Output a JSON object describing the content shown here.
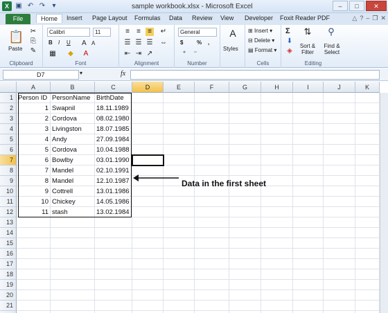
{
  "window": {
    "title": "sample workbook.xlsx - Microsoft Excel",
    "minimize": "–",
    "maximize": "□",
    "close": "✕"
  },
  "tabs": [
    "File",
    "Home",
    "Insert",
    "Page Layout",
    "Formulas",
    "Data",
    "Review",
    "View",
    "Developer",
    "Foxit Reader PDF"
  ],
  "ribbon": {
    "clipboard": {
      "label": "Clipboard",
      "paste": "Paste"
    },
    "font": {
      "label": "Font",
      "name": "Calibri",
      "size": "11",
      "bold": "B",
      "italic": "I",
      "underline": "U",
      "grow": "A",
      "shrink": "A"
    },
    "alignment": {
      "label": "Alignment"
    },
    "number": {
      "label": "Number",
      "format": "General",
      "currency": "$",
      "percent": "%",
      "comma": ","
    },
    "styles": {
      "label": "Styles"
    },
    "cells": {
      "label": "Cells",
      "insert": "Insert",
      "delete": "Delete",
      "format": "Format"
    },
    "editing": {
      "label": "Editing",
      "sum": "Σ",
      "sort": "Sort & Filter",
      "find": "Find & Select"
    }
  },
  "formula_bar": {
    "name_box": "D7",
    "fx": "fx",
    "value": ""
  },
  "columns": [
    "A",
    "B",
    "C",
    "D",
    "E",
    "F",
    "G",
    "H",
    "I",
    "J",
    "K"
  ],
  "rows": [
    "1",
    "2",
    "3",
    "4",
    "5",
    "6",
    "7",
    "8",
    "9",
    "10",
    "11",
    "12",
    "13",
    "14",
    "15",
    "16",
    "17",
    "18",
    "19",
    "20",
    "21",
    "22"
  ],
  "selected_cell": {
    "column": "D",
    "row": "7"
  },
  "headers": [
    "Person ID",
    "PersonName",
    "BirthDate"
  ],
  "records": [
    {
      "id": "1",
      "name": "Swapnil",
      "date": "18.11.1989"
    },
    {
      "id": "2",
      "name": "Cordova",
      "date": "08.02.1980"
    },
    {
      "id": "3",
      "name": "Livingston",
      "date": "18.07.1985"
    },
    {
      "id": "4",
      "name": "Andy",
      "date": "27.09.1984"
    },
    {
      "id": "5",
      "name": "Cordova",
      "date": "10.04.1988"
    },
    {
      "id": "6",
      "name": "Bowlby",
      "date": "03.01.1990"
    },
    {
      "id": "7",
      "name": "Mandel",
      "date": "02.10.1991"
    },
    {
      "id": "8",
      "name": "Mandel",
      "date": "12.10.1987"
    },
    {
      "id": "9",
      "name": "Cottrell",
      "date": "13.01.1986"
    },
    {
      "id": "10",
      "name": "Chickey",
      "date": "14.05.1986"
    },
    {
      "id": "11",
      "name": "stash",
      "date": "13.02.1984"
    }
  ],
  "annotation": "Data in the first sheet"
}
